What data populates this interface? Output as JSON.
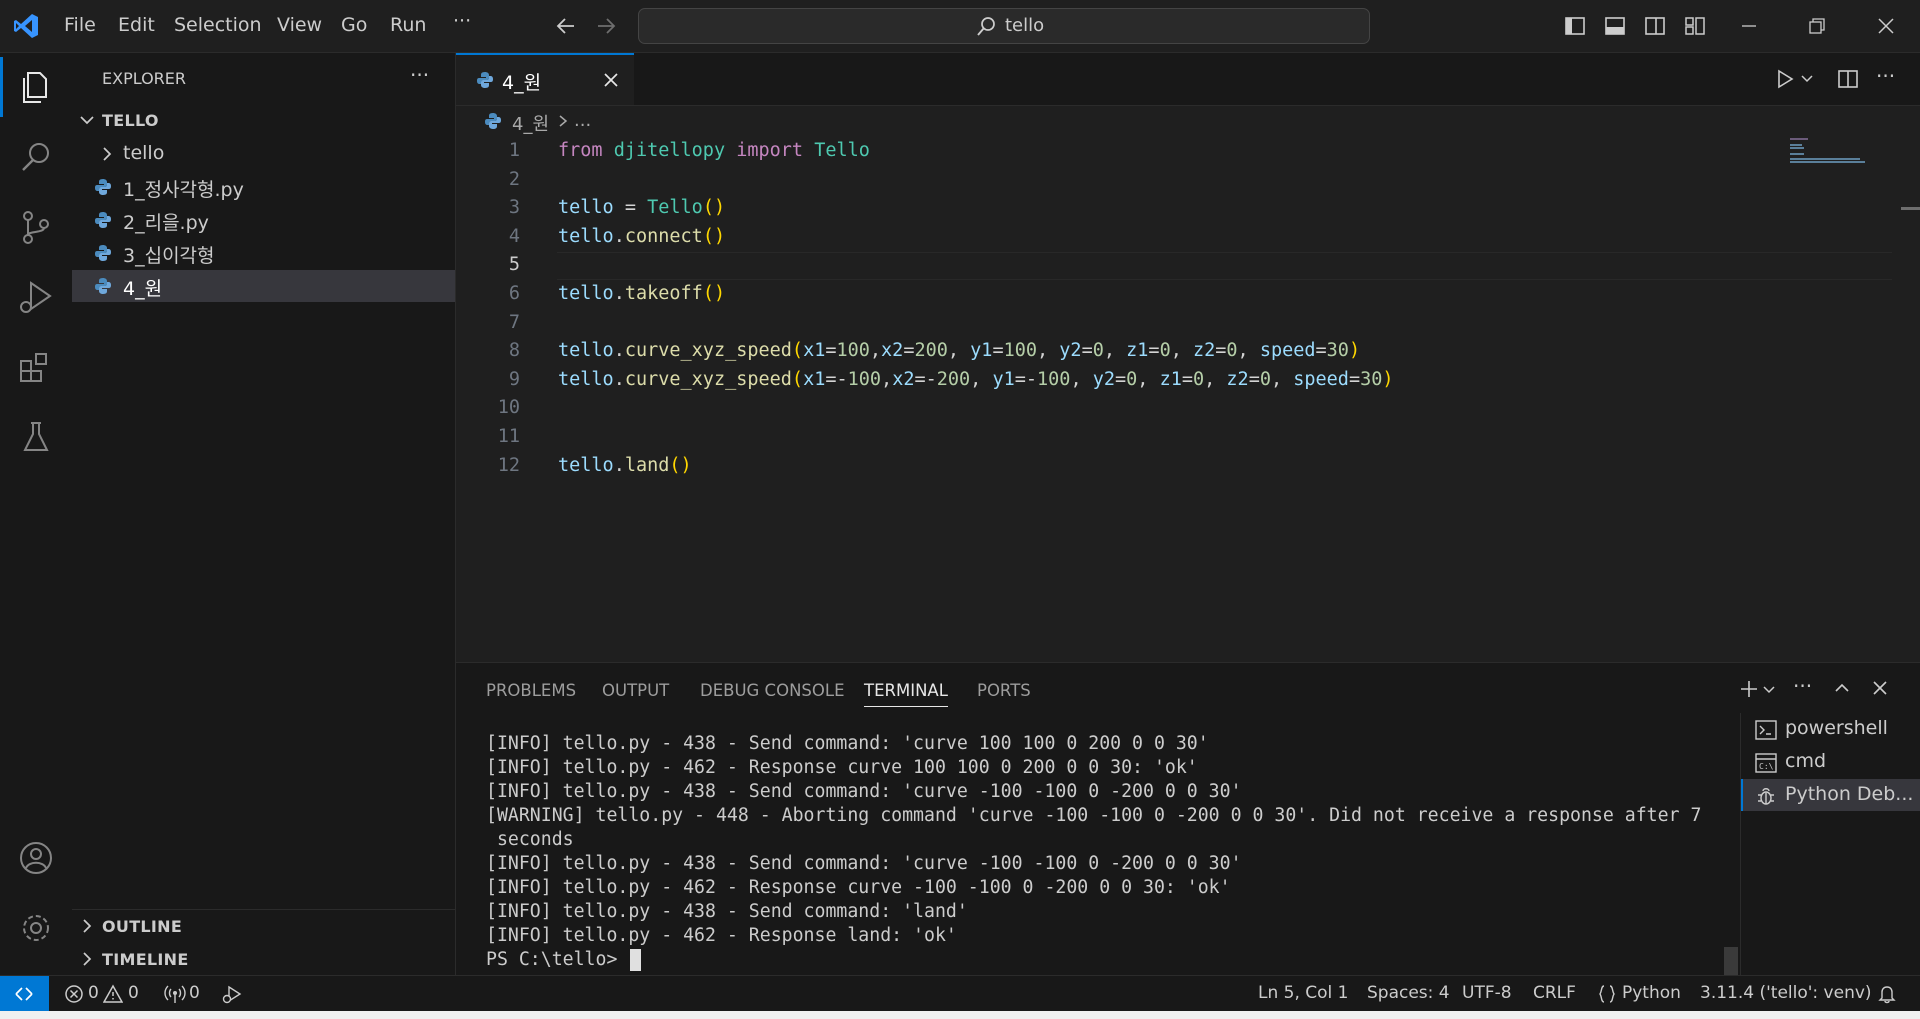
{
  "titlebar": {
    "menus": [
      "File",
      "Edit",
      "Selection",
      "View",
      "Go",
      "Run",
      "···"
    ],
    "search_text": "tello"
  },
  "sidebar": {
    "title": "EXPLORER",
    "more": "···",
    "folder_label": "TELLO",
    "items": [
      {
        "label": "tello",
        "kind": "folder"
      },
      {
        "label": "1_정사각형.py",
        "kind": "python-file"
      },
      {
        "label": "2_리을.py",
        "kind": "python-file"
      },
      {
        "label": "3_십이각형",
        "kind": "python-file"
      },
      {
        "label": "4_원",
        "kind": "python-file",
        "selected": true
      }
    ],
    "outline_label": "OUTLINE",
    "timeline_label": "TIMELINE"
  },
  "editor": {
    "tab_label": "4_원",
    "breadcrumb_file": "4_원",
    "breadcrumb_rest": "...",
    "current_line": 5,
    "lines": [
      {
        "n": "1",
        "segments": [
          [
            "k",
            "from"
          ],
          [
            "p",
            " "
          ],
          [
            "m",
            "djitellopy"
          ],
          [
            "p",
            " "
          ],
          [
            "k",
            "import"
          ],
          [
            "p",
            " "
          ],
          [
            "c",
            "Tello"
          ]
        ]
      },
      {
        "n": "2",
        "segments": []
      },
      {
        "n": "3",
        "segments": [
          [
            "v",
            "tello"
          ],
          [
            "p",
            " = "
          ],
          [
            "c",
            "Tello"
          ],
          [
            "b",
            "()"
          ]
        ]
      },
      {
        "n": "4",
        "segments": [
          [
            "v",
            "tello"
          ],
          [
            "p",
            "."
          ],
          [
            "f",
            "connect"
          ],
          [
            "b",
            "()"
          ]
        ]
      },
      {
        "n": "5",
        "segments": []
      },
      {
        "n": "6",
        "segments": [
          [
            "v",
            "tello"
          ],
          [
            "p",
            "."
          ],
          [
            "f",
            "takeoff"
          ],
          [
            "b",
            "()"
          ]
        ]
      },
      {
        "n": "7",
        "segments": []
      },
      {
        "n": "8",
        "segments": [
          [
            "v",
            "tello"
          ],
          [
            "p",
            "."
          ],
          [
            "f",
            "curve_xyz_speed"
          ],
          [
            "b",
            "("
          ],
          [
            "v",
            "x1"
          ],
          [
            "p",
            "="
          ],
          [
            "n",
            "100"
          ],
          [
            "p",
            ","
          ],
          [
            "v",
            "x2"
          ],
          [
            "p",
            "="
          ],
          [
            "n",
            "200"
          ],
          [
            "p",
            ", "
          ],
          [
            "v",
            "y1"
          ],
          [
            "p",
            "="
          ],
          [
            "n",
            "100"
          ],
          [
            "p",
            ", "
          ],
          [
            "v",
            "y2"
          ],
          [
            "p",
            "="
          ],
          [
            "n",
            "0"
          ],
          [
            "p",
            ", "
          ],
          [
            "v",
            "z1"
          ],
          [
            "p",
            "="
          ],
          [
            "n",
            "0"
          ],
          [
            "p",
            ", "
          ],
          [
            "v",
            "z2"
          ],
          [
            "p",
            "="
          ],
          [
            "n",
            "0"
          ],
          [
            "p",
            ", "
          ],
          [
            "v",
            "speed"
          ],
          [
            "p",
            "="
          ],
          [
            "n",
            "30"
          ],
          [
            "b",
            ")"
          ]
        ]
      },
      {
        "n": "9",
        "segments": [
          [
            "v",
            "tello"
          ],
          [
            "p",
            "."
          ],
          [
            "f",
            "curve_xyz_speed"
          ],
          [
            "b",
            "("
          ],
          [
            "v",
            "x1"
          ],
          [
            "p",
            "=-"
          ],
          [
            "n",
            "100"
          ],
          [
            "p",
            ","
          ],
          [
            "v",
            "x2"
          ],
          [
            "p",
            "=-"
          ],
          [
            "n",
            "200"
          ],
          [
            "p",
            ", "
          ],
          [
            "v",
            "y1"
          ],
          [
            "p",
            "=-"
          ],
          [
            "n",
            "100"
          ],
          [
            "p",
            ", "
          ],
          [
            "v",
            "y2"
          ],
          [
            "p",
            "="
          ],
          [
            "n",
            "0"
          ],
          [
            "p",
            ", "
          ],
          [
            "v",
            "z1"
          ],
          [
            "p",
            "="
          ],
          [
            "n",
            "0"
          ],
          [
            "p",
            ", "
          ],
          [
            "v",
            "z2"
          ],
          [
            "p",
            "="
          ],
          [
            "n",
            "0"
          ],
          [
            "p",
            ", "
          ],
          [
            "v",
            "speed"
          ],
          [
            "p",
            "="
          ],
          [
            "n",
            "30"
          ],
          [
            "b",
            ")"
          ]
        ]
      },
      {
        "n": "10",
        "segments": []
      },
      {
        "n": "11",
        "segments": []
      },
      {
        "n": "12",
        "segments": [
          [
            "v",
            "tello"
          ],
          [
            "p",
            "."
          ],
          [
            "f",
            "land"
          ],
          [
            "b",
            "()"
          ]
        ]
      }
    ]
  },
  "panel": {
    "tabs": [
      "PROBLEMS",
      "OUTPUT",
      "DEBUG CONSOLE",
      "TERMINAL",
      "PORTS"
    ],
    "active_tab": "TERMINAL",
    "terminal_lines": [
      "[INFO] tello.py - 438 - Send command: 'curve 100 100 0 200 0 0 30'",
      "[INFO] tello.py - 462 - Response curve 100 100 0 200 0 0 30: 'ok'",
      "[INFO] tello.py - 438 - Send command: 'curve -100 -100 0 -200 0 0 30'",
      "[WARNING] tello.py - 448 - Aborting command 'curve -100 -100 0 -200 0 0 30'. Did not receive a response after 7",
      " seconds",
      "[INFO] tello.py - 438 - Send command: 'curve -100 -100 0 -200 0 0 30'",
      "[INFO] tello.py - 462 - Response curve -100 -100 0 -200 0 0 30: 'ok'",
      "[INFO] tello.py - 438 - Send command: 'land'",
      "[INFO] tello.py - 462 - Response land: 'ok'",
      "PS C:\\tello> "
    ],
    "terminals": [
      {
        "label": "powershell",
        "icon": "powershell-icon"
      },
      {
        "label": "cmd",
        "icon": "cmd-icon"
      },
      {
        "label": "Python Deb...",
        "icon": "debug-icon",
        "active": true
      }
    ]
  },
  "statusbar": {
    "errors": "0",
    "warnings": "0",
    "ports": "0",
    "position": "Ln 5, Col 1",
    "spaces": "Spaces: 4",
    "encoding": "UTF-8",
    "eol": "CRLF",
    "language": "Python",
    "interpreter": "3.11.4 ('tello': venv)"
  },
  "colors": {
    "accent": "#0078d4",
    "remote": "#0078d4",
    "keyword": "#c586c0",
    "variable": "#9cdcfe",
    "function": "#dcdcaa",
    "class": "#4ec9b0",
    "number": "#b5cea8",
    "bracket": "#ffd700"
  }
}
